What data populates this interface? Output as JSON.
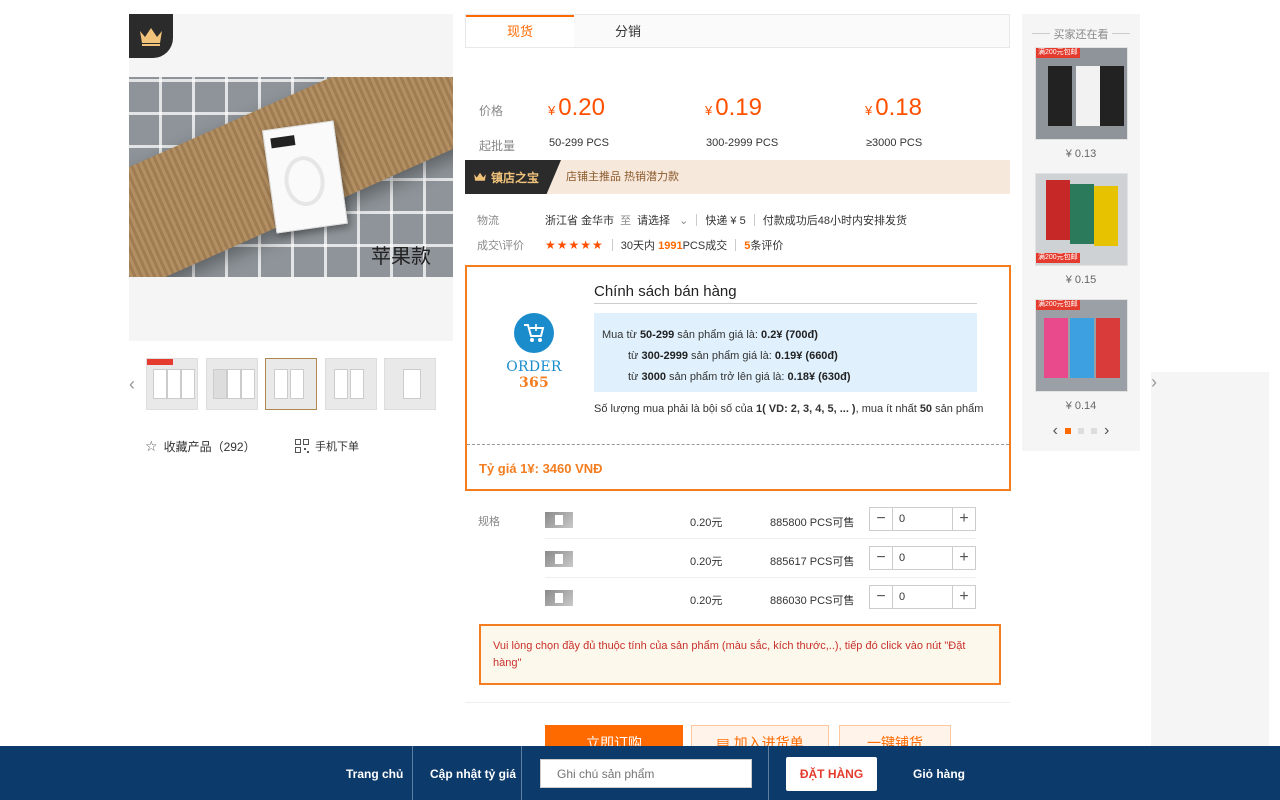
{
  "gallery": {
    "caption": "苹果款",
    "favorite_label": "收藏产品（292）",
    "mobile_order_label": "手机下单"
  },
  "tabs": [
    {
      "label": "现货",
      "active": true
    },
    {
      "label": "分销",
      "active": false
    }
  ],
  "pricing": {
    "price_label": "价格",
    "moq_label": "起批量",
    "currency": "¥",
    "tiers": [
      {
        "price": "0.20",
        "range": "50-299",
        "unit": "PCS"
      },
      {
        "price": "0.19",
        "range": "300-2999",
        "unit": "PCS"
      },
      {
        "price": "0.18",
        "range": "≥3000",
        "unit": "PCS"
      }
    ]
  },
  "shop_banner": {
    "badge": "镇店之宝",
    "slogan": "店铺主推品  热销潜力款"
  },
  "logistics": {
    "label": "物流",
    "origin": "浙江省 金华市",
    "to": "至",
    "destination": "请选择",
    "shipping": "快递 ¥ 5",
    "dispatch": "付款成功后48小时内安排发货"
  },
  "reviews": {
    "label": "成交\\评价",
    "stars": "★★★★★",
    "sales_prefix": "30天内",
    "sales_count": "1991",
    "sales_suffix": "PCS成交",
    "review_count": "5",
    "review_suffix": "条评价"
  },
  "policy": {
    "logo_order": "ORDER",
    "logo_num": "365",
    "title": "Chính sách bán hàng",
    "tier1_a": "Mua từ ",
    "tier1_b": "50-299",
    "tier1_c": " sản phẩm giá là: ",
    "tier1_d": "0.2¥ (700đ)",
    "tier2_a": "từ ",
    "tier2_b": "300-2999",
    "tier2_c": " sản phẩm giá là: ",
    "tier2_d": "0.19¥ (660đ)",
    "tier3_a": "từ ",
    "tier3_b": "3000",
    "tier3_c": " sản phẩm trở lên giá là: ",
    "tier3_d": "0.18¥ (630đ)",
    "note_a": "Số lượng mua phải là bội số của ",
    "note_b": "1( VD: 2, 3, 4, 5, ... )",
    "note_c": ", mua ít nhất ",
    "note_d": "50",
    "note_e": " sản phẩm",
    "rate": "Tỷ giá 1¥: 3460 VNĐ"
  },
  "specs": {
    "label": "规格",
    "rows": [
      {
        "price": "0.20元",
        "stock": "885800 PCS可售",
        "qty": "0"
      },
      {
        "price": "0.20元",
        "stock": "885617 PCS可售",
        "qty": "0"
      },
      {
        "price": "0.20元",
        "stock": "886030 PCS可售",
        "qty": "0"
      }
    ]
  },
  "warning": "Vui lòng chọn đầy đủ thuộc tính của sản phẩm (màu sắc, kích thước,..), tiếp đó click vào nút \"Đặt hàng\"",
  "actions": {
    "buy_now": "立即订购",
    "add_cart": "加入进货单",
    "one_click": "一键铺货"
  },
  "recommend": {
    "title": "买家还在看",
    "tag": "满200元包邮",
    "items": [
      {
        "price": "¥ 0.13"
      },
      {
        "price": "¥ 0.15"
      },
      {
        "price": "¥ 0.14"
      }
    ]
  },
  "bottom_bar": {
    "home": "Trang chủ",
    "update_rate": "Cập nhật tỷ giá",
    "note_placeholder": "Ghi chú sản phẩm",
    "order_button": "ĐẶT HÀNG",
    "cart": "Giỏ hàng"
  },
  "colors": {
    "accent": "#ff6a00",
    "price": "#ff5000",
    "policy_border": "#f47d20",
    "bottom_bar": "#0b3a6b"
  }
}
